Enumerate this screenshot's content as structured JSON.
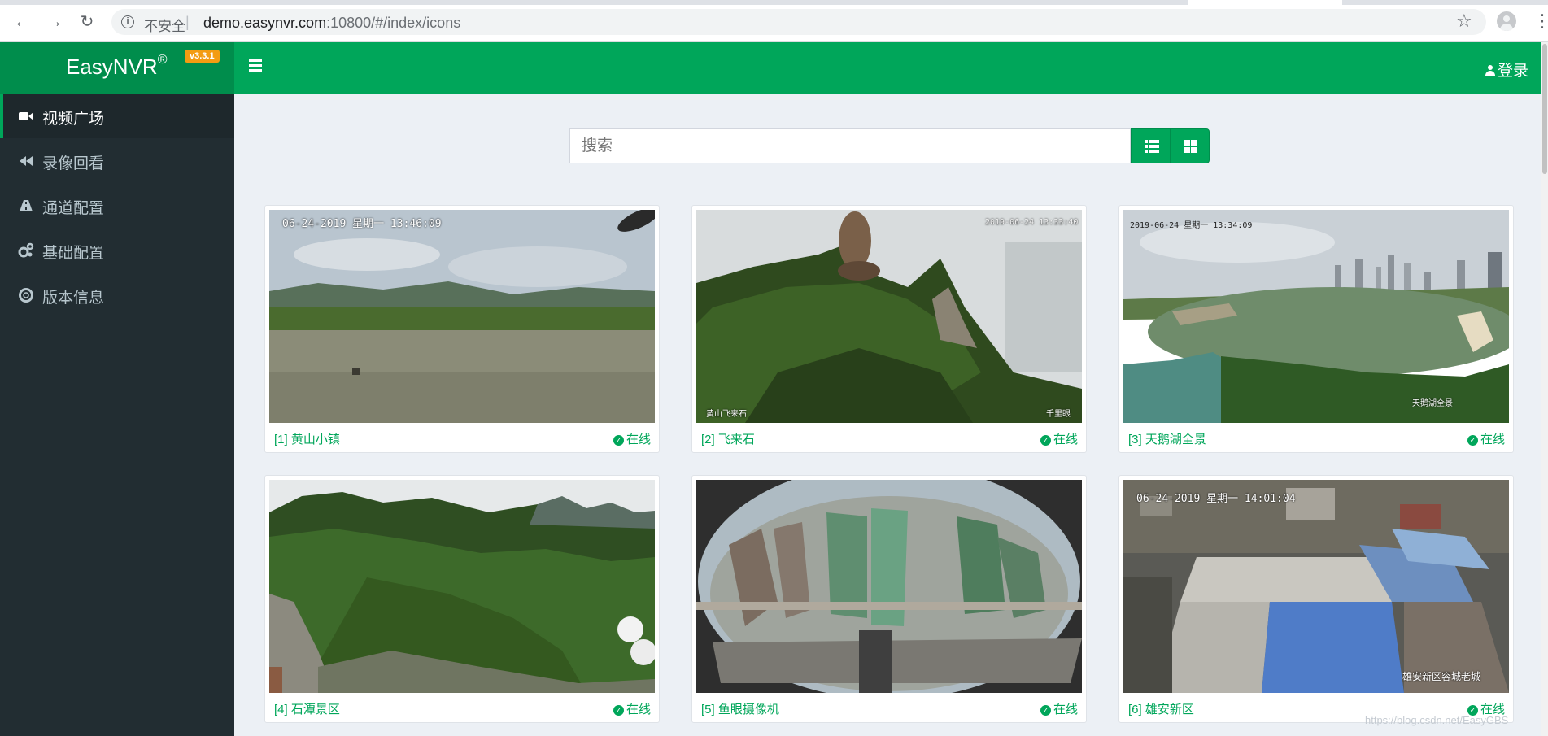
{
  "browser": {
    "security_label": "不安全",
    "url_host": "demo.easynvr.com",
    "url_rest": ":10800/#/index/icons"
  },
  "header": {
    "brand": "EasyNVR",
    "brand_mark": "®",
    "version": "v3.3.1",
    "login_label": "登录"
  },
  "sidebar": {
    "items": [
      {
        "label": "视频广场",
        "icon": "video-camera-icon",
        "active": true
      },
      {
        "label": "录像回看",
        "icon": "backward-icon",
        "active": false
      },
      {
        "label": "通道配置",
        "icon": "road-icon",
        "active": false
      },
      {
        "label": "基础配置",
        "icon": "cogs-icon",
        "active": false
      },
      {
        "label": "版本信息",
        "icon": "support-icon",
        "active": false
      }
    ]
  },
  "search": {
    "placeholder": "搜索"
  },
  "channels": [
    {
      "title": "[1] 黄山小镇",
      "status": "在线",
      "osd": "06-24-2019  星期一  13:46:09"
    },
    {
      "title": "[2] 飞来石",
      "status": "在线",
      "osd": "2019-06-24 13:33:40",
      "osd_bl": "黄山飞来石",
      "osd_br": "千里眼"
    },
    {
      "title": "[3] 天鹅湖全景",
      "status": "在线",
      "osd": "2019-06-24  星期一  13:34:09",
      "osd_br": "天鹅湖全景"
    },
    {
      "title": "[4] 石潭景区",
      "status": "在线"
    },
    {
      "title": "[5] 鱼眼摄像机",
      "status": "在线"
    },
    {
      "title": "[6] 雄安新区",
      "status": "在线",
      "osd": "06-24-2019  星期一  14:01:04",
      "osd_br": "雄安新区容城老城"
    }
  ],
  "watermark": "https://blog.csdn.net/EasyGBS",
  "colors": {
    "brand_green": "#00a65a",
    "brand_green_dark": "#008d4c",
    "sidebar_bg": "#222d32",
    "badge_orange": "#f39c12"
  }
}
